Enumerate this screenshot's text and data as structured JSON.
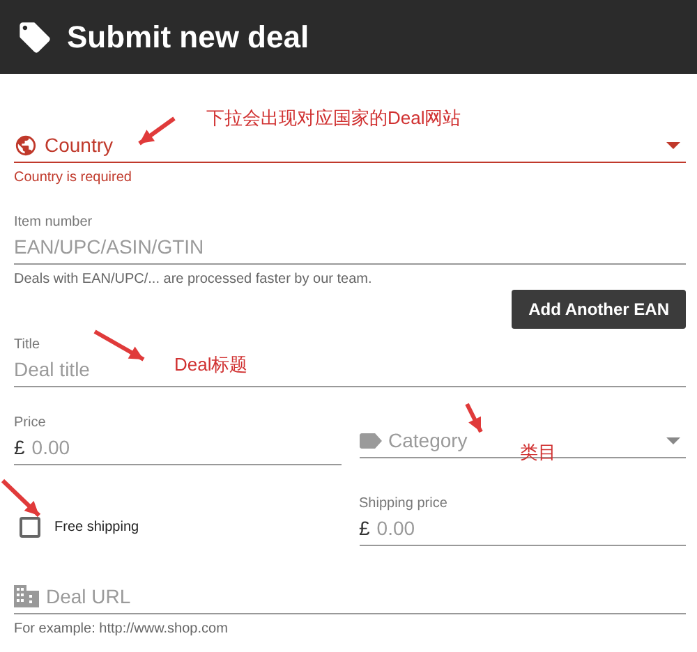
{
  "header": {
    "title": "Submit new deal"
  },
  "country": {
    "placeholder": "Country",
    "error": "Country is required"
  },
  "item_number": {
    "label": "Item number",
    "placeholder": "EAN/UPC/ASIN/GTIN",
    "hint": "Deals with EAN/UPC/... are processed faster by our team.",
    "button": "Add Another EAN"
  },
  "title_field": {
    "label": "Title",
    "placeholder": "Deal title"
  },
  "price": {
    "label": "Price",
    "currency": "£",
    "placeholder": "0.00"
  },
  "category": {
    "placeholder": "Category"
  },
  "free_shipping": {
    "label": "Free shipping",
    "checked": false
  },
  "shipping_price": {
    "label": "Shipping price",
    "currency": "£",
    "placeholder": "0.00"
  },
  "deal_url": {
    "placeholder": "Deal URL",
    "hint": "For example: http://www.shop.com"
  },
  "annotations": [
    {
      "text": "下拉会出现对应国家的Deal网站"
    },
    {
      "text": "Deal标题"
    },
    {
      "text": "类目"
    }
  ]
}
